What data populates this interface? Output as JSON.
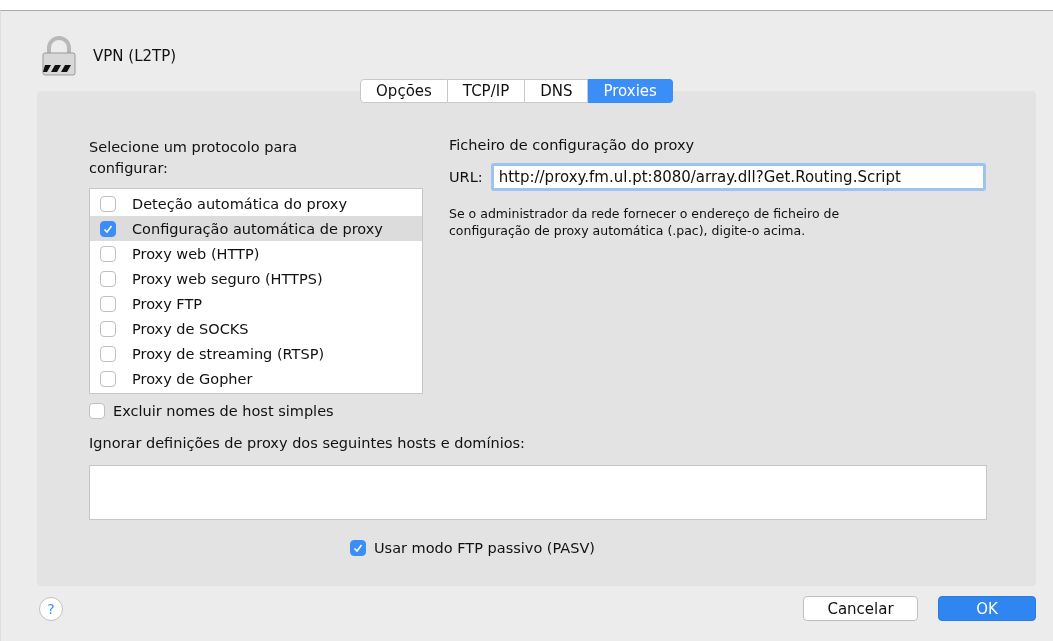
{
  "window": {
    "title": "VPN (L2TP)"
  },
  "tabs": [
    {
      "label": "Opções",
      "selected": false
    },
    {
      "label": "TCP/IP",
      "selected": false
    },
    {
      "label": "DNS",
      "selected": false
    },
    {
      "label": "Proxies",
      "selected": true
    }
  ],
  "protocols": {
    "heading": "Selecione um protocolo para configurar:",
    "items": [
      {
        "label": "Deteção automática do proxy",
        "checked": false,
        "selected": false
      },
      {
        "label": "Configuração automática de proxy",
        "checked": true,
        "selected": true
      },
      {
        "label": "Proxy web (HTTP)",
        "checked": false,
        "selected": false
      },
      {
        "label": "Proxy web seguro (HTTPS)",
        "checked": false,
        "selected": false
      },
      {
        "label": "Proxy FTP",
        "checked": false,
        "selected": false
      },
      {
        "label": "Proxy de SOCKS",
        "checked": false,
        "selected": false
      },
      {
        "label": "Proxy de streaming (RTSP)",
        "checked": false,
        "selected": false
      },
      {
        "label": "Proxy de Gopher",
        "checked": false,
        "selected": false
      }
    ]
  },
  "config_file": {
    "heading": "Ficheiro de configuração do proxy",
    "url_label": "URL:",
    "url_value": "http://proxy.fm.ul.pt:8080/array.dll?Get.Routing.Script",
    "help_text": "Se o administrador da rede fornecer o endereço de ficheiro de configuração de proxy automática (.pac), digite-o acima."
  },
  "exclude_simple": {
    "label": "Excluir nomes de host simples",
    "checked": false
  },
  "bypass": {
    "label": "Ignorar definições de proxy dos seguintes hosts e domínios:"
  },
  "passive_ftp": {
    "label": "Usar modo FTP passivo (PASV)",
    "checked": true
  },
  "help_button": "?",
  "buttons": [
    {
      "label": "Cancelar",
      "kind": "secondary"
    },
    {
      "label": "OK",
      "kind": "primary"
    }
  ]
}
